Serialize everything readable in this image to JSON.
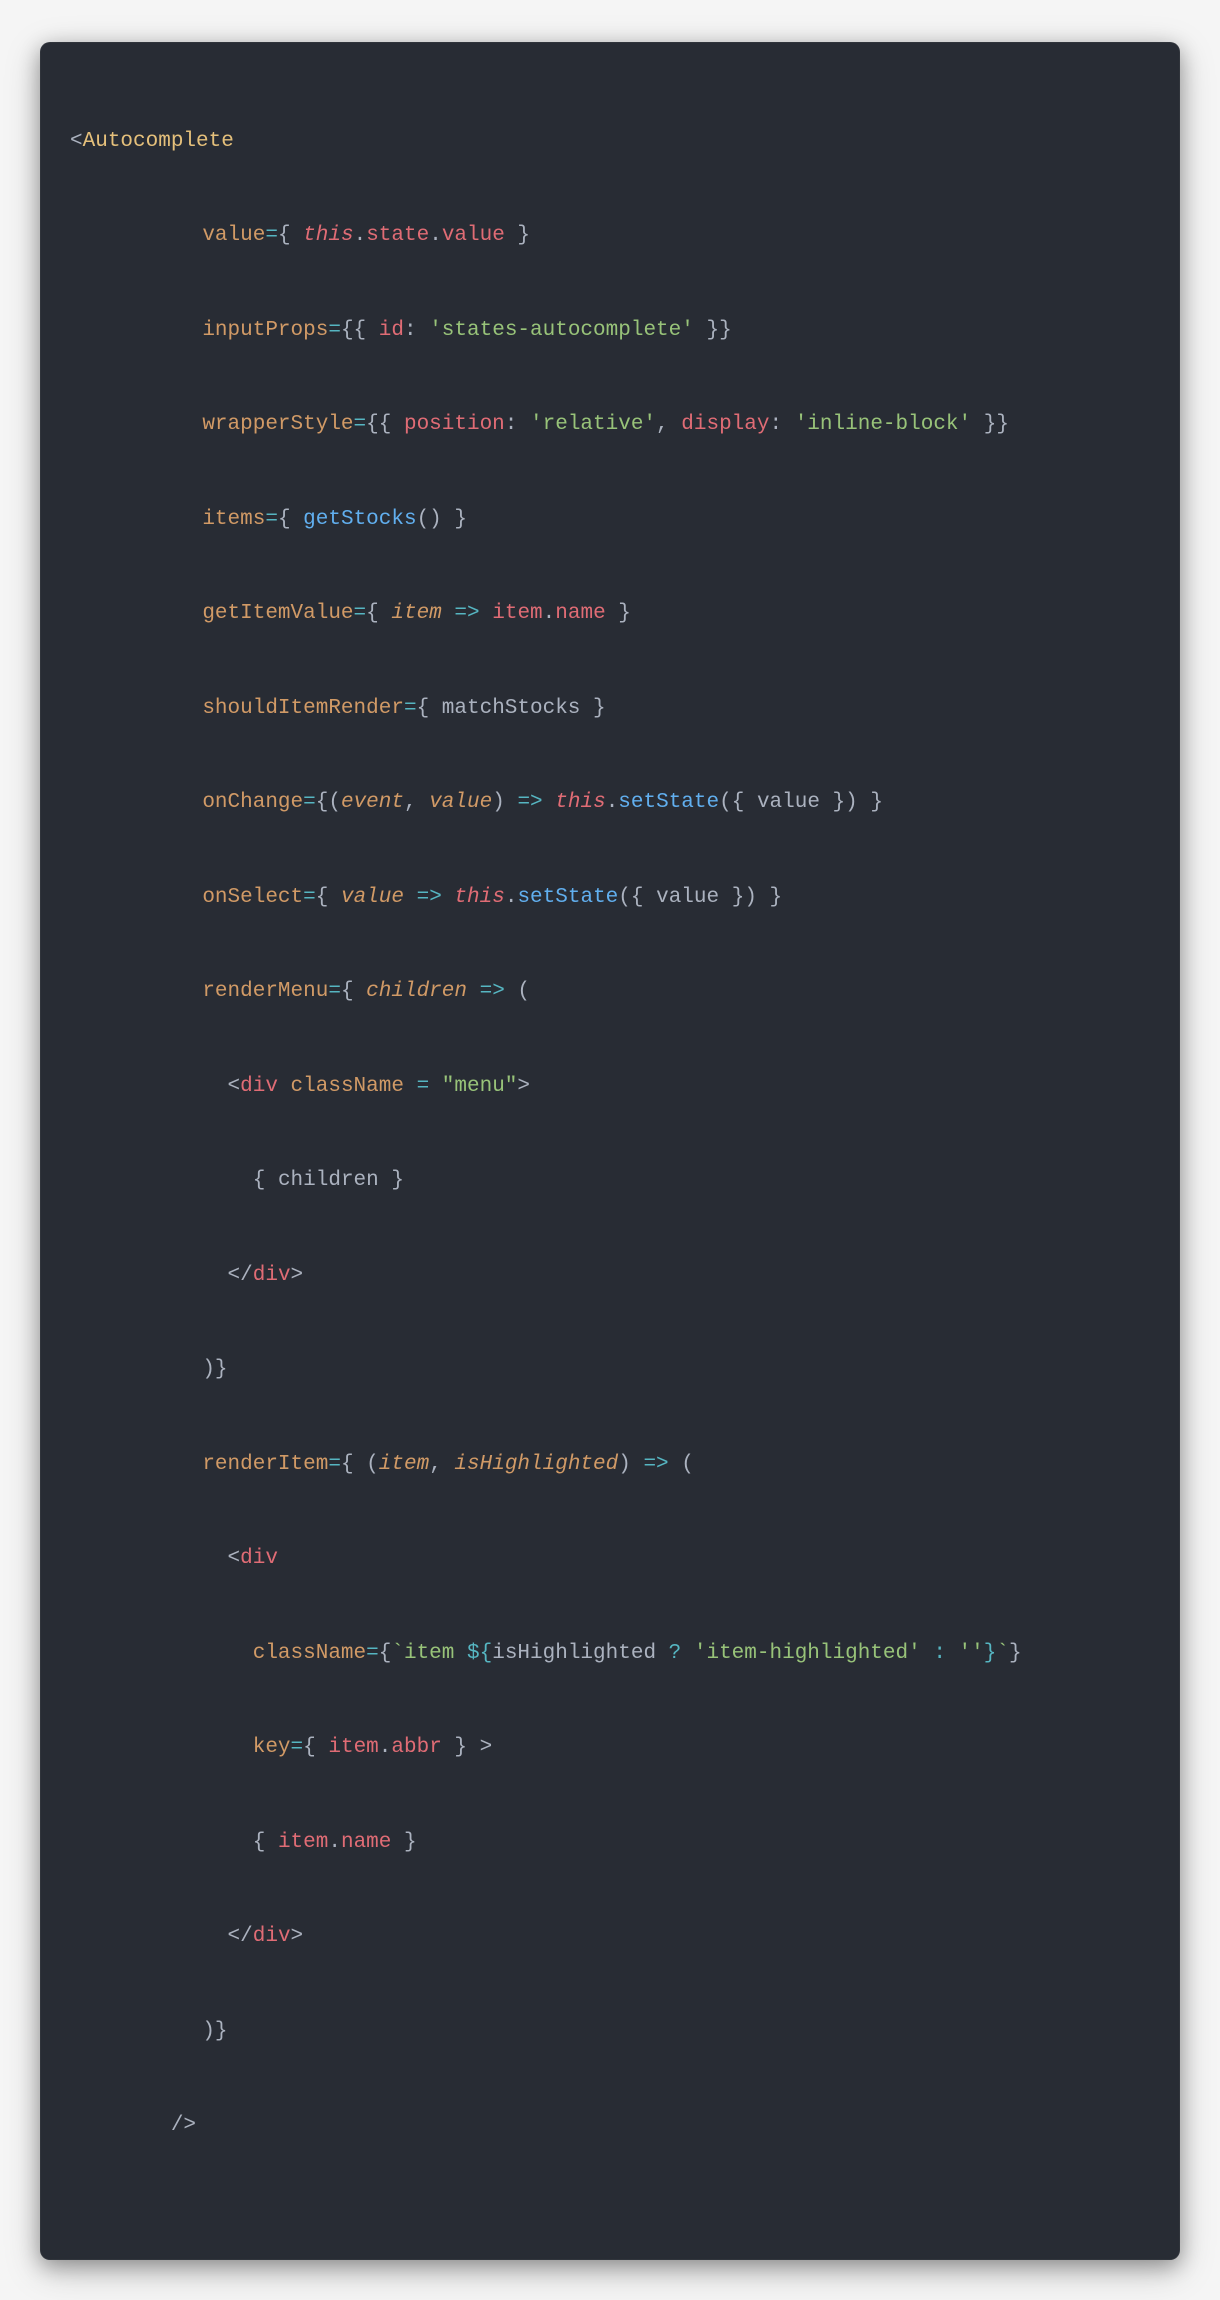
{
  "code": {
    "component": "Autocomplete",
    "props": {
      "value_this": "this",
      "value_state": "state",
      "value_prop": "value",
      "inputProps_id_key": "id",
      "inputProps_id_val": "'states-autocomplete'",
      "wrapperStyle_position_key": "position",
      "wrapperStyle_position_val": "'relative'",
      "wrapperStyle_display_key": "display",
      "wrapperStyle_display_val": "'inline-block'",
      "items_call": "getStocks",
      "getItemValue_param": "item",
      "getItemValue_body_obj": "item",
      "getItemValue_body_prop": "name",
      "shouldItemRender_fn": "matchStocks",
      "onChange_event": "event",
      "onChange_value": "value",
      "onChange_this": "this",
      "onChange_call": "setState",
      "onChange_arg": "value",
      "onSelect_value": "value",
      "onSelect_this": "this",
      "onSelect_call": "setState",
      "onSelect_arg": "value",
      "renderMenu_param": "children",
      "renderMenu_div_class": "\"menu\"",
      "renderMenu_children": "children",
      "renderItem_item": "item",
      "renderItem_hl": "isHighlighted",
      "renderItem_tpl_item": "item",
      "renderItem_tpl_hl": "isHighlighted",
      "renderItem_tpl_true": "'item-highlighted'",
      "renderItem_tpl_false": "''",
      "renderItem_key_obj": "item",
      "renderItem_key_prop": "abbr",
      "renderItem_body_obj": "item",
      "renderItem_body_prop": "name"
    },
    "labels": {
      "value": "value",
      "inputProps": "inputProps",
      "wrapperStyle": "wrapperStyle",
      "items": "items",
      "getItemValue": "getItemValue",
      "shouldItemRender": "shouldItemRender",
      "onChange": "onChange",
      "onSelect": "onSelect",
      "renderMenu": "renderMenu",
      "renderItem": "renderItem",
      "div": "div",
      "className": "className",
      "key": "key"
    }
  }
}
